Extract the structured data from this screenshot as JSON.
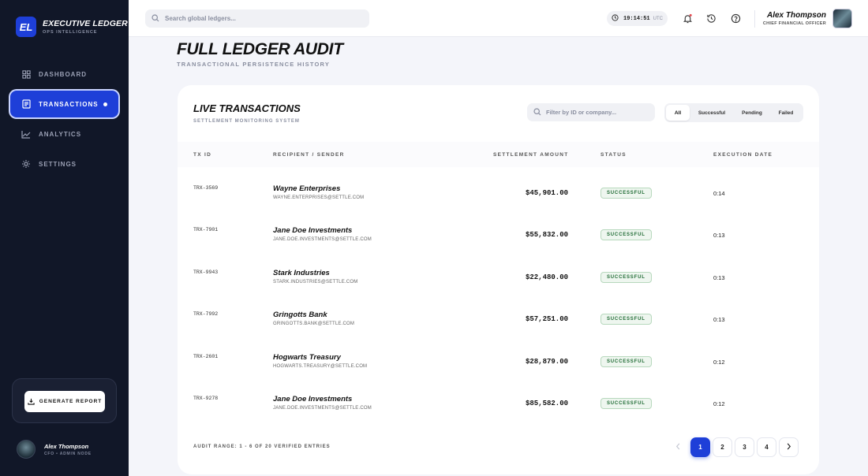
{
  "brand": {
    "logo": "EL",
    "title": "EXECUTIVE LEDGER",
    "subtitle": "OPS INTELLIGENCE"
  },
  "nav": {
    "items": [
      {
        "label": "DASHBOARD",
        "icon": "grid-icon"
      },
      {
        "label": "TRANSACTIONS",
        "icon": "document-icon",
        "active": true
      },
      {
        "label": "ANALYTICS",
        "icon": "chart-line-icon"
      },
      {
        "label": "SETTINGS",
        "icon": "gear-icon"
      }
    ]
  },
  "sidebar": {
    "report_label": "GENERATE REPORT",
    "user_name": "Alex Thompson",
    "user_role": "CFO • ADMIN NODE"
  },
  "topbar": {
    "search_placeholder": "Search global ledgers...",
    "time": "19:14:51",
    "zone": "UTC",
    "user_name": "Alex Thompson",
    "user_role": "CHIEF FINANCIAL OFFICER"
  },
  "page": {
    "title": "FULL LEDGER AUDIT",
    "subtitle": "TRANSACTIONAL PERSISTENCE HISTORY"
  },
  "card": {
    "title": "LIVE TRANSACTIONS",
    "subtitle": "SETTLEMENT MONITORING SYSTEM",
    "filter_placeholder": "Filter by ID or company...",
    "filters": [
      "All",
      "Successful",
      "Pending",
      "Failed"
    ],
    "active_filter": "All",
    "columns": [
      "TX ID",
      "RECIPIENT / SENDER",
      "SETTLEMENT AMOUNT",
      "STATUS",
      "EXECUTION DATE"
    ],
    "rows": [
      {
        "id": "TRX-3569",
        "name": "Wayne Enterprises",
        "email": "WAYNE.ENTERPRISES@SETTLE.COM",
        "amount": "$45,901.00",
        "status": "SUCCESSFUL",
        "date": "0:14"
      },
      {
        "id": "TRX-7901",
        "name": "Jane Doe Investments",
        "email": "JANE.DOE.INVESTMENTS@SETTLE.COM",
        "amount": "$55,832.00",
        "status": "SUCCESSFUL",
        "date": "0:13"
      },
      {
        "id": "TRX-9943",
        "name": "Stark Industries",
        "email": "STARK.INDUSTRIES@SETTLE.COM",
        "amount": "$22,480.00",
        "status": "SUCCESSFUL",
        "date": "0:13"
      },
      {
        "id": "TRX-7992",
        "name": "Gringotts Bank",
        "email": "GRINGOTTS.BANK@SETTLE.COM",
        "amount": "$57,251.00",
        "status": "SUCCESSFUL",
        "date": "0:13"
      },
      {
        "id": "TRX-2601",
        "name": "Hogwarts Treasury",
        "email": "HOGWARTS.TREASURY@SETTLE.COM",
        "amount": "$28,879.00",
        "status": "SUCCESSFUL",
        "date": "0:12"
      },
      {
        "id": "TRX-9278",
        "name": "Jane Doe Investments",
        "email": "JANE.DOE.INVESTMENTS@SETTLE.COM",
        "amount": "$85,582.00",
        "status": "SUCCESSFUL",
        "date": "0:12"
      }
    ],
    "footer": "AUDIT RANGE: 1 - 6 OF 20 VERIFIED ENTRIES",
    "pages": [
      "1",
      "2",
      "3",
      "4"
    ],
    "current_page": "1"
  },
  "colors": {
    "accent": "#1e3fd8",
    "sidebar": "#111728",
    "success_text": "#1f6b34"
  }
}
